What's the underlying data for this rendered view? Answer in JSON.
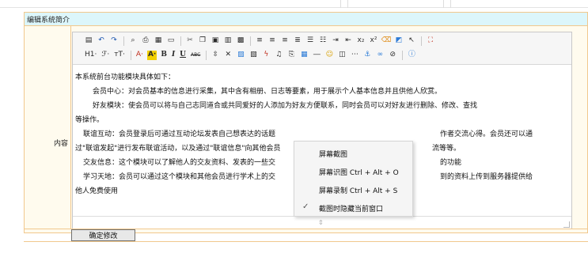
{
  "header": {
    "title": "编辑系统简介"
  },
  "form": {
    "content_label": "内容",
    "submit_label": "确定修改"
  },
  "toolbar": {
    "row1": [
      "source-icon",
      "undo-icon",
      "redo-icon",
      "find-icon",
      "print-icon",
      "template-icon",
      "preview-icon",
      "cut-icon",
      "copy-icon",
      "paste-icon",
      "paste-text-icon",
      "paste-word-icon",
      "align-left-icon",
      "align-center-icon",
      "align-right-icon",
      "justify-icon",
      "ordered-list-icon",
      "unordered-list-icon",
      "indent-icon",
      "outdent-icon",
      "subscript-icon",
      "superscript-icon",
      "clear-format-icon",
      "select-all-icon",
      "cursor-icon",
      "fullscreen-icon"
    ],
    "row2": [
      {
        "name": "heading-menu",
        "text": "H1·"
      },
      {
        "name": "font-family-menu",
        "text": "ℱ·"
      },
      {
        "name": "font-size-menu",
        "text": "тT·"
      },
      {
        "name": "font-color-menu",
        "text": "A·"
      },
      {
        "name": "background-color-menu",
        "text": "A·"
      },
      {
        "name": "bold-button",
        "text": "B"
      },
      {
        "name": "italic-button",
        "text": "I"
      },
      {
        "name": "underline-button",
        "text": "U"
      },
      {
        "name": "strikethrough-button",
        "text": "ABC"
      }
    ],
    "row2_icons": [
      "line-height-icon",
      "remove-format-icon",
      "image-icon",
      "multi-image-icon",
      "flash-icon",
      "media-icon",
      "insert-file-icon",
      "table-icon",
      "horizontal-rule-icon",
      "emoticon-icon",
      "map-icon",
      "page-break-icon",
      "anchor-icon",
      "link-icon",
      "unlink-icon",
      "about-icon"
    ]
  },
  "content": {
    "lines": [
      "本系统前台功能模块具体如下：",
      "会员中心：对会员基本的信息进行采集，其中含有相册、日志等要素，用于展示个人基本信息并且供他人欣赏。",
      "好友模块：使会员可以将与自己志同道合或共同爱好的人添加为好友方便联系，同时会员可以对好友进行删除、修改、查找",
      "等操作。",
      "联谊互动：会员登录后可通过互动论坛发表自己想表达的话题",
      "作者交流心得。会员还可以通",
      "过\"联谊发起\"进行发布联谊活动，以及通过\"联谊信息\"向其他会员",
      "流等等。",
      "交友信息：这个模块可以了解他人的交友资料、发表的一些交",
      "的功能",
      "学习天地：会员可以通过这个模块和其他会员进行学术上的交",
      "到的资料上传到服务器提供给",
      "他人免费使用"
    ]
  },
  "context_menu": {
    "items": [
      {
        "label": "屏幕截图",
        "checked": false
      },
      {
        "label": "屏幕识图 Ctrl + Alt + O",
        "checked": false
      },
      {
        "label": "屏幕录制 Ctrl + Alt + S",
        "checked": false
      },
      {
        "label": "截图时隐藏当前窗口",
        "checked": true
      }
    ],
    "check_glyph": "✓"
  }
}
